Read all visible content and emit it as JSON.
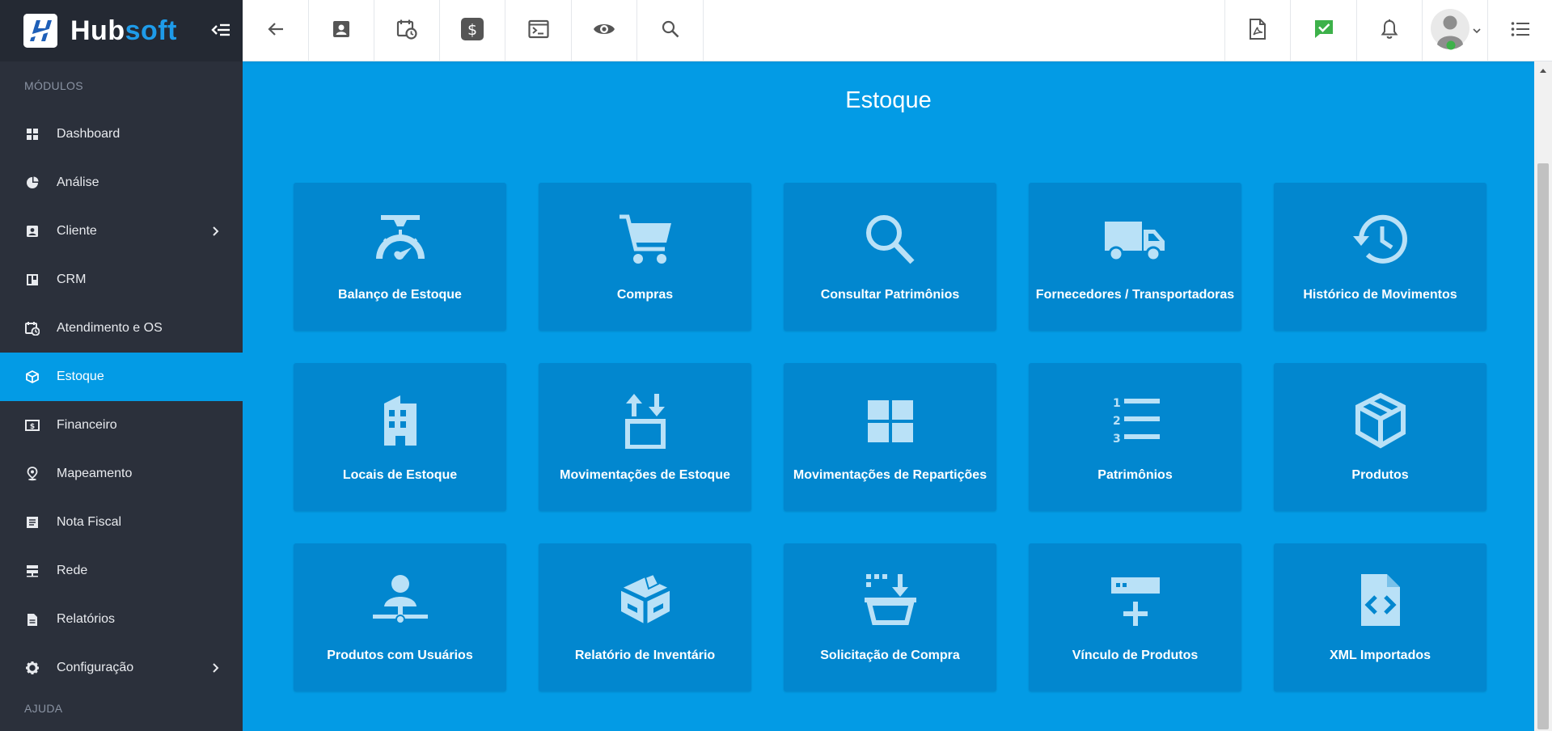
{
  "brand": {
    "name_part1": "Hub",
    "name_part2": "soft"
  },
  "sidebar": {
    "section_modules": "MÓDULOS",
    "section_help": "AJUDA",
    "items": [
      {
        "label": "Dashboard",
        "icon": "dashboard-icon"
      },
      {
        "label": "Análise",
        "icon": "pie-chart-icon"
      },
      {
        "label": "Cliente",
        "icon": "contact-card-icon",
        "has_submenu": true
      },
      {
        "label": "CRM",
        "icon": "board-icon"
      },
      {
        "label": "Atendimento e OS",
        "icon": "calendar-clock-icon"
      },
      {
        "label": "Estoque",
        "icon": "box-icon",
        "active": true
      },
      {
        "label": "Financeiro",
        "icon": "money-icon"
      },
      {
        "label": "Mapeamento",
        "icon": "map-pin-icon"
      },
      {
        "label": "Nota Fiscal",
        "icon": "document-icon"
      },
      {
        "label": "Rede",
        "icon": "server-icon"
      },
      {
        "label": "Relatórios",
        "icon": "report-icon"
      },
      {
        "label": "Configuração",
        "icon": "gear-icon",
        "has_submenu": true
      }
    ]
  },
  "topbar": {
    "left_icons": [
      "back-arrow-icon",
      "contact-card-icon",
      "calendar-clock-icon",
      "dollar-icon",
      "terminal-icon",
      "eye-icon",
      "search-icon"
    ],
    "right_icons": [
      "pdf-icon",
      "chat-check-icon",
      "bell-icon",
      "avatar",
      "list-menu-icon"
    ]
  },
  "page": {
    "title": "Estoque",
    "tiles": [
      {
        "label": "Balanço de Estoque",
        "icon": "scale-icon"
      },
      {
        "label": "Compras",
        "icon": "shopping-cart-icon"
      },
      {
        "label": "Consultar Patrimônios",
        "icon": "search-icon"
      },
      {
        "label": "Fornecedores / Transportadoras",
        "icon": "truck-icon"
      },
      {
        "label": "Histórico de Movimentos",
        "icon": "history-icon"
      },
      {
        "label": "Locais de Estoque",
        "icon": "building-icon"
      },
      {
        "label": "Movimentações de Estoque",
        "icon": "box-transfer-icon"
      },
      {
        "label": "Movimentações de Repartições",
        "icon": "grid-icon"
      },
      {
        "label": "Patrimônios",
        "icon": "numbered-list-icon"
      },
      {
        "label": "Produtos",
        "icon": "cube-icon"
      },
      {
        "label": "Produtos com Usuários",
        "icon": "user-network-icon"
      },
      {
        "label": "Relatório de Inventário",
        "icon": "open-box-icon"
      },
      {
        "label": "Solicitação de Compra",
        "icon": "basket-download-icon"
      },
      {
        "label": "Vínculo de Produtos",
        "icon": "add-link-icon"
      },
      {
        "label": "XML Importados",
        "icon": "code-file-icon"
      }
    ]
  },
  "colors": {
    "sidebar_bg": "#2b303b",
    "accent": "#039be5",
    "tile_bg": "#0287cf",
    "tile_icon": "#b9e1f7"
  }
}
